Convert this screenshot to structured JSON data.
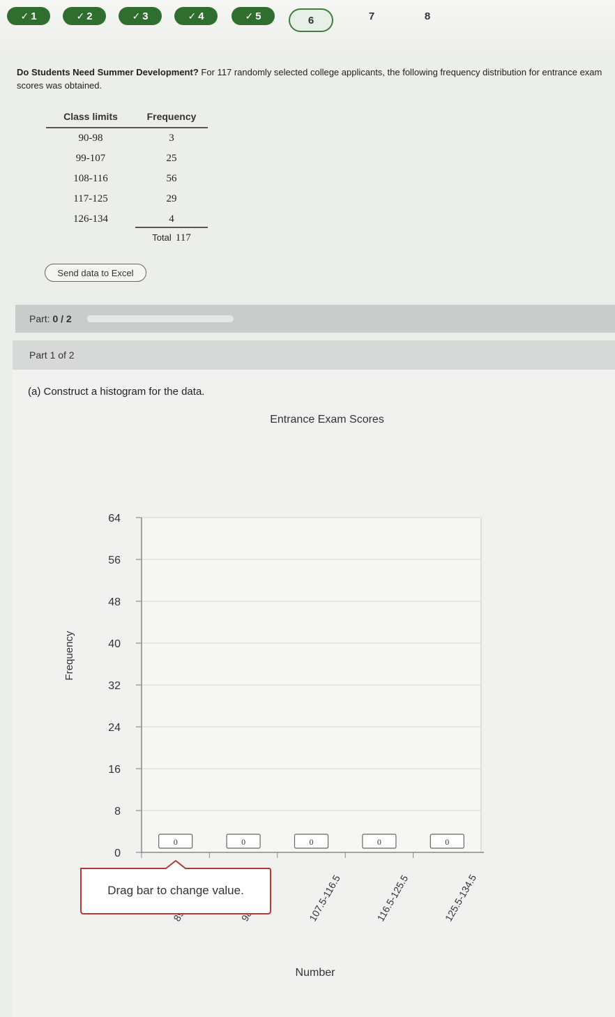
{
  "nav": {
    "steps": [
      {
        "label": "1",
        "state": "done"
      },
      {
        "label": "2",
        "state": "done"
      },
      {
        "label": "3",
        "state": "done"
      },
      {
        "label": "4",
        "state": "done"
      },
      {
        "label": "5",
        "state": "done"
      },
      {
        "label": "6",
        "state": "current"
      },
      {
        "label": "7",
        "state": "todo"
      },
      {
        "label": "8",
        "state": "todo"
      }
    ],
    "check_glyph": "✓"
  },
  "problem": {
    "title": "Do Students Need Summer Development?",
    "text": "For 117 randomly selected college applicants, the following frequency distribution for entrance exam scores was obtained."
  },
  "table": {
    "headers": [
      "Class limits",
      "Frequency"
    ],
    "rows": [
      [
        "90-98",
        "3"
      ],
      [
        "99-107",
        "25"
      ],
      [
        "108-116",
        "56"
      ],
      [
        "117-125",
        "29"
      ],
      [
        "126-134",
        "4"
      ]
    ],
    "total_label": "Total",
    "total_value": "117"
  },
  "send_button": "Send data to Excel",
  "part_status": {
    "label": "Part:",
    "value": "0 / 2",
    "progress": 0
  },
  "part_header": "Part 1 of 2",
  "question": "(a) Construct a histogram for the data.",
  "tooltip": "Drag bar to change value.",
  "colors": {
    "done": "#2f6e2f",
    "tooltip_border": "#b33a3a"
  },
  "chart_data": {
    "type": "bar",
    "title": "Entrance Exam Scores",
    "xlabel": "Number",
    "ylabel": "Frequency",
    "ylim": [
      0,
      64
    ],
    "yticks": [
      0,
      8,
      16,
      24,
      32,
      40,
      48,
      56,
      64
    ],
    "categories": [
      "89.5-98.5",
      "98.5-107.5",
      "107.5-116.5",
      "116.5-125.5",
      "125.5-134.5"
    ],
    "category_labels_shown": [
      "89.",
      "98.",
      "107.5-116.5",
      "116.5-125.5",
      "125.5-134.5"
    ],
    "values": [
      0,
      0,
      0,
      0,
      0
    ],
    "grid": true
  }
}
